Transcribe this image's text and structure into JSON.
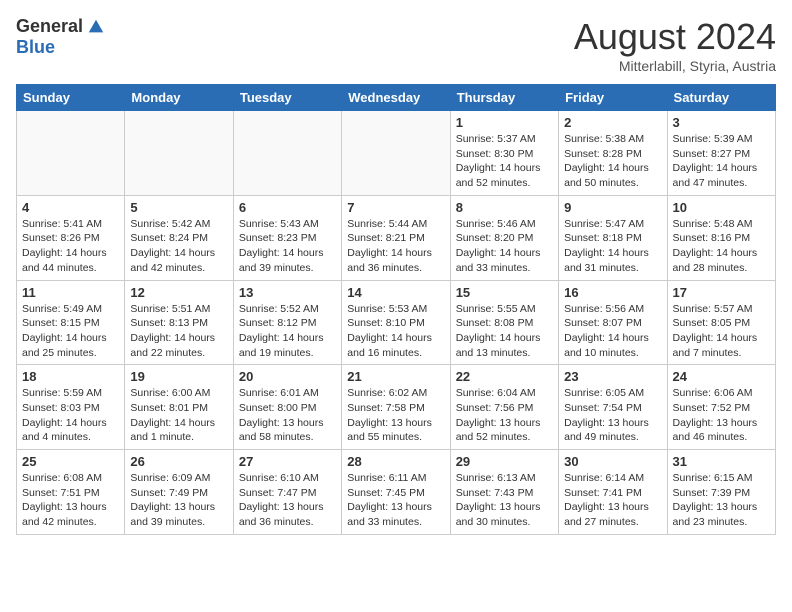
{
  "header": {
    "logo_general": "General",
    "logo_blue": "Blue",
    "month_year": "August 2024",
    "location": "Mitterlabill, Styria, Austria"
  },
  "days_of_week": [
    "Sunday",
    "Monday",
    "Tuesday",
    "Wednesday",
    "Thursday",
    "Friday",
    "Saturday"
  ],
  "weeks": [
    [
      {
        "day": "",
        "info": ""
      },
      {
        "day": "",
        "info": ""
      },
      {
        "day": "",
        "info": ""
      },
      {
        "day": "",
        "info": ""
      },
      {
        "day": "1",
        "info": "Sunrise: 5:37 AM\nSunset: 8:30 PM\nDaylight: 14 hours\nand 52 minutes."
      },
      {
        "day": "2",
        "info": "Sunrise: 5:38 AM\nSunset: 8:28 PM\nDaylight: 14 hours\nand 50 minutes."
      },
      {
        "day": "3",
        "info": "Sunrise: 5:39 AM\nSunset: 8:27 PM\nDaylight: 14 hours\nand 47 minutes."
      }
    ],
    [
      {
        "day": "4",
        "info": "Sunrise: 5:41 AM\nSunset: 8:26 PM\nDaylight: 14 hours\nand 44 minutes."
      },
      {
        "day": "5",
        "info": "Sunrise: 5:42 AM\nSunset: 8:24 PM\nDaylight: 14 hours\nand 42 minutes."
      },
      {
        "day": "6",
        "info": "Sunrise: 5:43 AM\nSunset: 8:23 PM\nDaylight: 14 hours\nand 39 minutes."
      },
      {
        "day": "7",
        "info": "Sunrise: 5:44 AM\nSunset: 8:21 PM\nDaylight: 14 hours\nand 36 minutes."
      },
      {
        "day": "8",
        "info": "Sunrise: 5:46 AM\nSunset: 8:20 PM\nDaylight: 14 hours\nand 33 minutes."
      },
      {
        "day": "9",
        "info": "Sunrise: 5:47 AM\nSunset: 8:18 PM\nDaylight: 14 hours\nand 31 minutes."
      },
      {
        "day": "10",
        "info": "Sunrise: 5:48 AM\nSunset: 8:16 PM\nDaylight: 14 hours\nand 28 minutes."
      }
    ],
    [
      {
        "day": "11",
        "info": "Sunrise: 5:49 AM\nSunset: 8:15 PM\nDaylight: 14 hours\nand 25 minutes."
      },
      {
        "day": "12",
        "info": "Sunrise: 5:51 AM\nSunset: 8:13 PM\nDaylight: 14 hours\nand 22 minutes."
      },
      {
        "day": "13",
        "info": "Sunrise: 5:52 AM\nSunset: 8:12 PM\nDaylight: 14 hours\nand 19 minutes."
      },
      {
        "day": "14",
        "info": "Sunrise: 5:53 AM\nSunset: 8:10 PM\nDaylight: 14 hours\nand 16 minutes."
      },
      {
        "day": "15",
        "info": "Sunrise: 5:55 AM\nSunset: 8:08 PM\nDaylight: 14 hours\nand 13 minutes."
      },
      {
        "day": "16",
        "info": "Sunrise: 5:56 AM\nSunset: 8:07 PM\nDaylight: 14 hours\nand 10 minutes."
      },
      {
        "day": "17",
        "info": "Sunrise: 5:57 AM\nSunset: 8:05 PM\nDaylight: 14 hours\nand 7 minutes."
      }
    ],
    [
      {
        "day": "18",
        "info": "Sunrise: 5:59 AM\nSunset: 8:03 PM\nDaylight: 14 hours\nand 4 minutes."
      },
      {
        "day": "19",
        "info": "Sunrise: 6:00 AM\nSunset: 8:01 PM\nDaylight: 14 hours\nand 1 minute."
      },
      {
        "day": "20",
        "info": "Sunrise: 6:01 AM\nSunset: 8:00 PM\nDaylight: 13 hours\nand 58 minutes."
      },
      {
        "day": "21",
        "info": "Sunrise: 6:02 AM\nSunset: 7:58 PM\nDaylight: 13 hours\nand 55 minutes."
      },
      {
        "day": "22",
        "info": "Sunrise: 6:04 AM\nSunset: 7:56 PM\nDaylight: 13 hours\nand 52 minutes."
      },
      {
        "day": "23",
        "info": "Sunrise: 6:05 AM\nSunset: 7:54 PM\nDaylight: 13 hours\nand 49 minutes."
      },
      {
        "day": "24",
        "info": "Sunrise: 6:06 AM\nSunset: 7:52 PM\nDaylight: 13 hours\nand 46 minutes."
      }
    ],
    [
      {
        "day": "25",
        "info": "Sunrise: 6:08 AM\nSunset: 7:51 PM\nDaylight: 13 hours\nand 42 minutes."
      },
      {
        "day": "26",
        "info": "Sunrise: 6:09 AM\nSunset: 7:49 PM\nDaylight: 13 hours\nand 39 minutes."
      },
      {
        "day": "27",
        "info": "Sunrise: 6:10 AM\nSunset: 7:47 PM\nDaylight: 13 hours\nand 36 minutes."
      },
      {
        "day": "28",
        "info": "Sunrise: 6:11 AM\nSunset: 7:45 PM\nDaylight: 13 hours\nand 33 minutes."
      },
      {
        "day": "29",
        "info": "Sunrise: 6:13 AM\nSunset: 7:43 PM\nDaylight: 13 hours\nand 30 minutes."
      },
      {
        "day": "30",
        "info": "Sunrise: 6:14 AM\nSunset: 7:41 PM\nDaylight: 13 hours\nand 27 minutes."
      },
      {
        "day": "31",
        "info": "Sunrise: 6:15 AM\nSunset: 7:39 PM\nDaylight: 13 hours\nand 23 minutes."
      }
    ]
  ]
}
